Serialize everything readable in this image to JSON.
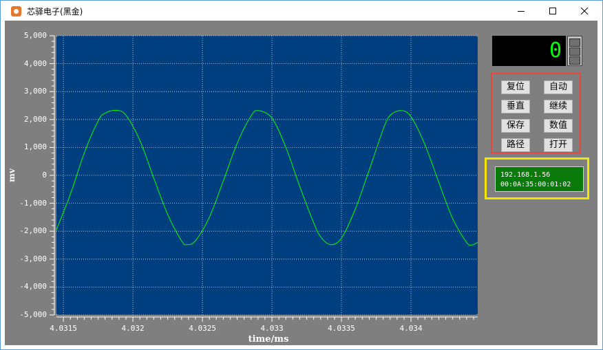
{
  "window": {
    "title": "芯驿电子(黑金)",
    "minimize_glyph": "—",
    "maximize_glyph": "☐",
    "close_glyph": "✕"
  },
  "display": {
    "counter_value": "0"
  },
  "buttons": {
    "reset": "复位",
    "auto": "自动",
    "vertical": "垂直",
    "resume": "继续",
    "save": "保存",
    "values": "数值",
    "path": "路径",
    "open": "打开"
  },
  "network": {
    "ip": "192.168.1.56",
    "mac": "00:0A:35:00:01:02"
  },
  "colors": {
    "plot_background": "#003f7f",
    "trace": "#00ff00",
    "grid": "#ffffff",
    "button_group_border": "#e8453c",
    "network_border": "#f2e600"
  },
  "chart_data": {
    "type": "line",
    "xlabel": "time/ms",
    "ylabel": "mv",
    "xlim": [
      4.03145,
      4.03448
    ],
    "ylim": [
      -5000,
      5000
    ],
    "x_ticks": [
      4.0315,
      4.032,
      4.0325,
      4.033,
      4.0335,
      4.034
    ],
    "x_tick_labels": [
      "4.0315",
      "4.032",
      "4.0325",
      "4.033",
      "4.0335",
      "4.034"
    ],
    "y_ticks": [
      5000,
      4000,
      3000,
      2000,
      1000,
      0,
      -1000,
      -2000,
      -3000,
      -4000,
      -5000
    ],
    "y_tick_labels": [
      "5,000",
      "4,000",
      "3,000",
      "2,000",
      "1,000",
      "0",
      "-1,000",
      "-2,000",
      "-3,000",
      "-4,000",
      "-5,000"
    ],
    "grid": true,
    "series": [
      {
        "x": [
          4.03145,
          4.03155,
          4.03165,
          4.03175,
          4.0318,
          4.03188,
          4.03195,
          4.03205,
          4.03215,
          4.03225,
          4.03235,
          4.03239,
          4.03245,
          4.03255,
          4.03265,
          4.03275,
          4.03285,
          4.0329,
          4.033,
          4.0331,
          4.0332,
          4.0333,
          4.03335,
          4.03342,
          4.0335,
          4.0336,
          4.0337,
          4.0338,
          4.03385,
          4.03393,
          4.034,
          4.0341,
          4.0342,
          4.0343,
          4.0344,
          4.03444,
          4.03448
        ],
        "y": [
          -1950,
          -680,
          800,
          1950,
          2230,
          2330,
          2150,
          1250,
          -100,
          -1400,
          -2350,
          -2480,
          -2340,
          -1500,
          -200,
          1150,
          2130,
          2320,
          2050,
          1000,
          -400,
          -1700,
          -2200,
          -2480,
          -2250,
          -1200,
          200,
          1650,
          2150,
          2320,
          2100,
          1100,
          -250,
          -1550,
          -2400,
          -2490,
          -2400
        ]
      }
    ]
  }
}
